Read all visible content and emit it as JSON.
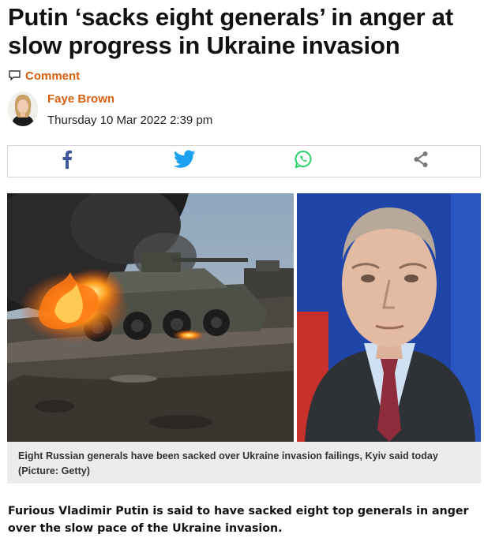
{
  "article": {
    "headline": "Putin ‘sacks eight generals’ in anger at slow progress in Ukraine invasion",
    "comment_label": "Comment",
    "author": "Faye Brown",
    "date": "Thursday 10 Mar 2022 2:39 pm",
    "caption": "Eight Russian generals have been sacked over Ukraine invasion failings, Kyiv said today (Picture: Getty)",
    "lede": "Furious Vladimir Putin is said to have sacked eight top generals in anger over the slow pace of the Ukraine invasion."
  },
  "share": {
    "buttons": [
      {
        "icon": "facebook-icon",
        "color": "#3b5998"
      },
      {
        "icon": "twitter-icon",
        "color": "#1da1f2"
      },
      {
        "icon": "whatsapp-icon",
        "color": "#25d366"
      },
      {
        "icon": "share-icon",
        "color": "#777777"
      }
    ]
  },
  "colors": {
    "accent": "#d9600f",
    "caption_bg": "#ececec"
  }
}
